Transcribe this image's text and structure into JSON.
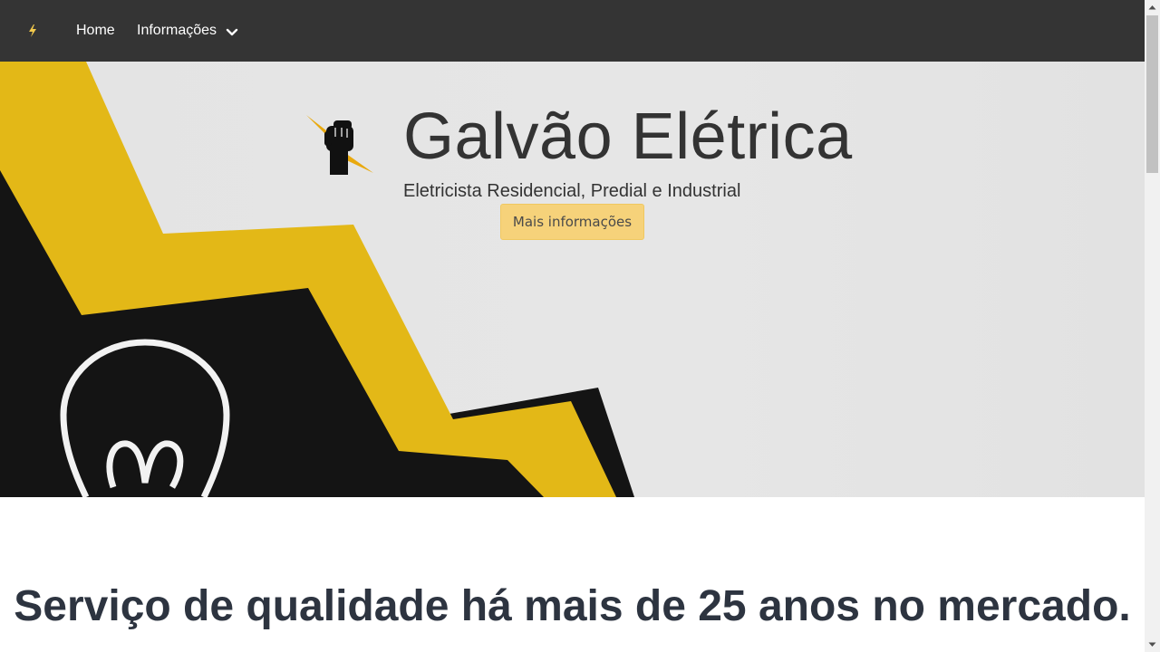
{
  "nav": {
    "brand_icon": "lightning-bolt-icon",
    "home_label": "Home",
    "info_label": "Informações"
  },
  "hero": {
    "logo": "fist-lightning-logo",
    "title": "Galvão Elétrica",
    "subtitle": "Eletricista Residencial, Predial e Industrial",
    "button_label": "Mais informações"
  },
  "section": {
    "tagline": "Serviço de qualidade há mais de 25 anos no mercado."
  },
  "colors": {
    "navbar": "#343434",
    "accent_yellow": "#e3b817",
    "button": "#f6d27a",
    "text_dark": "#333333"
  }
}
